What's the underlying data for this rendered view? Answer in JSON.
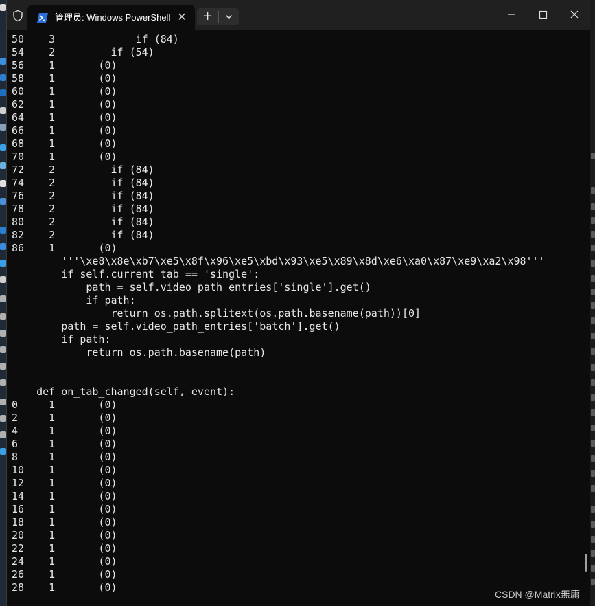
{
  "tab": {
    "title": "管理员: Windows PowerShell",
    "close_glyph": "✕"
  },
  "toolbar": {
    "new_tab_glyph": "+",
    "dropdown_icon": "chevron-down-icon"
  },
  "window_controls": {
    "minimize_glyph": "—",
    "maximize_glyph": "☐",
    "close_glyph": "✕"
  },
  "terminal": {
    "lines": [
      "50    3             if (84)",
      "54    2         if (54)",
      "56    1       (0)",
      "58    1       (0)",
      "60    1       (0)",
      "62    1       (0)",
      "64    1       (0)",
      "66    1       (0)",
      "68    1       (0)",
      "70    1       (0)",
      "72    2         if (84)",
      "74    2         if (84)",
      "76    2         if (84)",
      "78    2         if (84)",
      "80    2         if (84)",
      "82    2         if (84)",
      "86    1       (0)",
      "        '''\\xe8\\x8e\\xb7\\xe5\\x8f\\x96\\xe5\\xbd\\x93\\xe5\\x89\\x8d\\xe6\\xa0\\x87\\xe9\\xa2\\x98'''",
      "        if self.current_tab == 'single':",
      "            path = self.video_path_entries['single'].get()",
      "            if path:",
      "                return os.path.splitext(os.path.basename(path))[0]",
      "        path = self.video_path_entries['batch'].get()",
      "        if path:",
      "            return os.path.basename(path)",
      "",
      "",
      "    def on_tab_changed(self, event):",
      "0     1       (0)",
      "2     1       (0)",
      "4     1       (0)",
      "6     1       (0)",
      "8     1       (0)",
      "10    1       (0)",
      "12    1       (0)",
      "14    1       (0)",
      "16    1       (0)",
      "18    1       (0)",
      "20    1       (0)",
      "22    1       (0)",
      "24    1       (0)",
      "26    1       (0)",
      "28    1       (0)"
    ]
  },
  "watermark": "CSDN @Matrix無庸",
  "colors": {
    "terminal_bg": "#0c0c0c",
    "titlebar_bg": "#202020",
    "text": "#e6e6e6",
    "powershell_blue": "#2a6fd6"
  }
}
